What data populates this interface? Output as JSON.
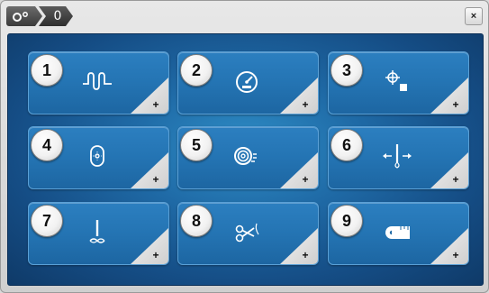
{
  "breadcrumb": {
    "items": [
      {
        "icon": "settings-toggle-icon"
      },
      {
        "text": "0"
      }
    ]
  },
  "close": {
    "label": "×"
  },
  "tiles": [
    {
      "number": "1",
      "icon": "stitch-loop-icon",
      "corner": "+"
    },
    {
      "number": "2",
      "icon": "speed-gauge-icon",
      "corner": "+"
    },
    {
      "number": "3",
      "icon": "crosshair-square-icon",
      "corner": "+"
    },
    {
      "number": "4",
      "icon": "hoop-icon",
      "corner": "+"
    },
    {
      "number": "5",
      "icon": "thread-spool-icon",
      "corner": "+"
    },
    {
      "number": "6",
      "icon": "needle-arrows-icon",
      "corner": "+"
    },
    {
      "number": "7",
      "icon": "needle-thread-icon",
      "corner": "+"
    },
    {
      "number": "8",
      "icon": "scissors-icon",
      "corner": "+"
    },
    {
      "number": "9",
      "icon": "tape-measure-icon",
      "corner": "+"
    }
  ]
}
